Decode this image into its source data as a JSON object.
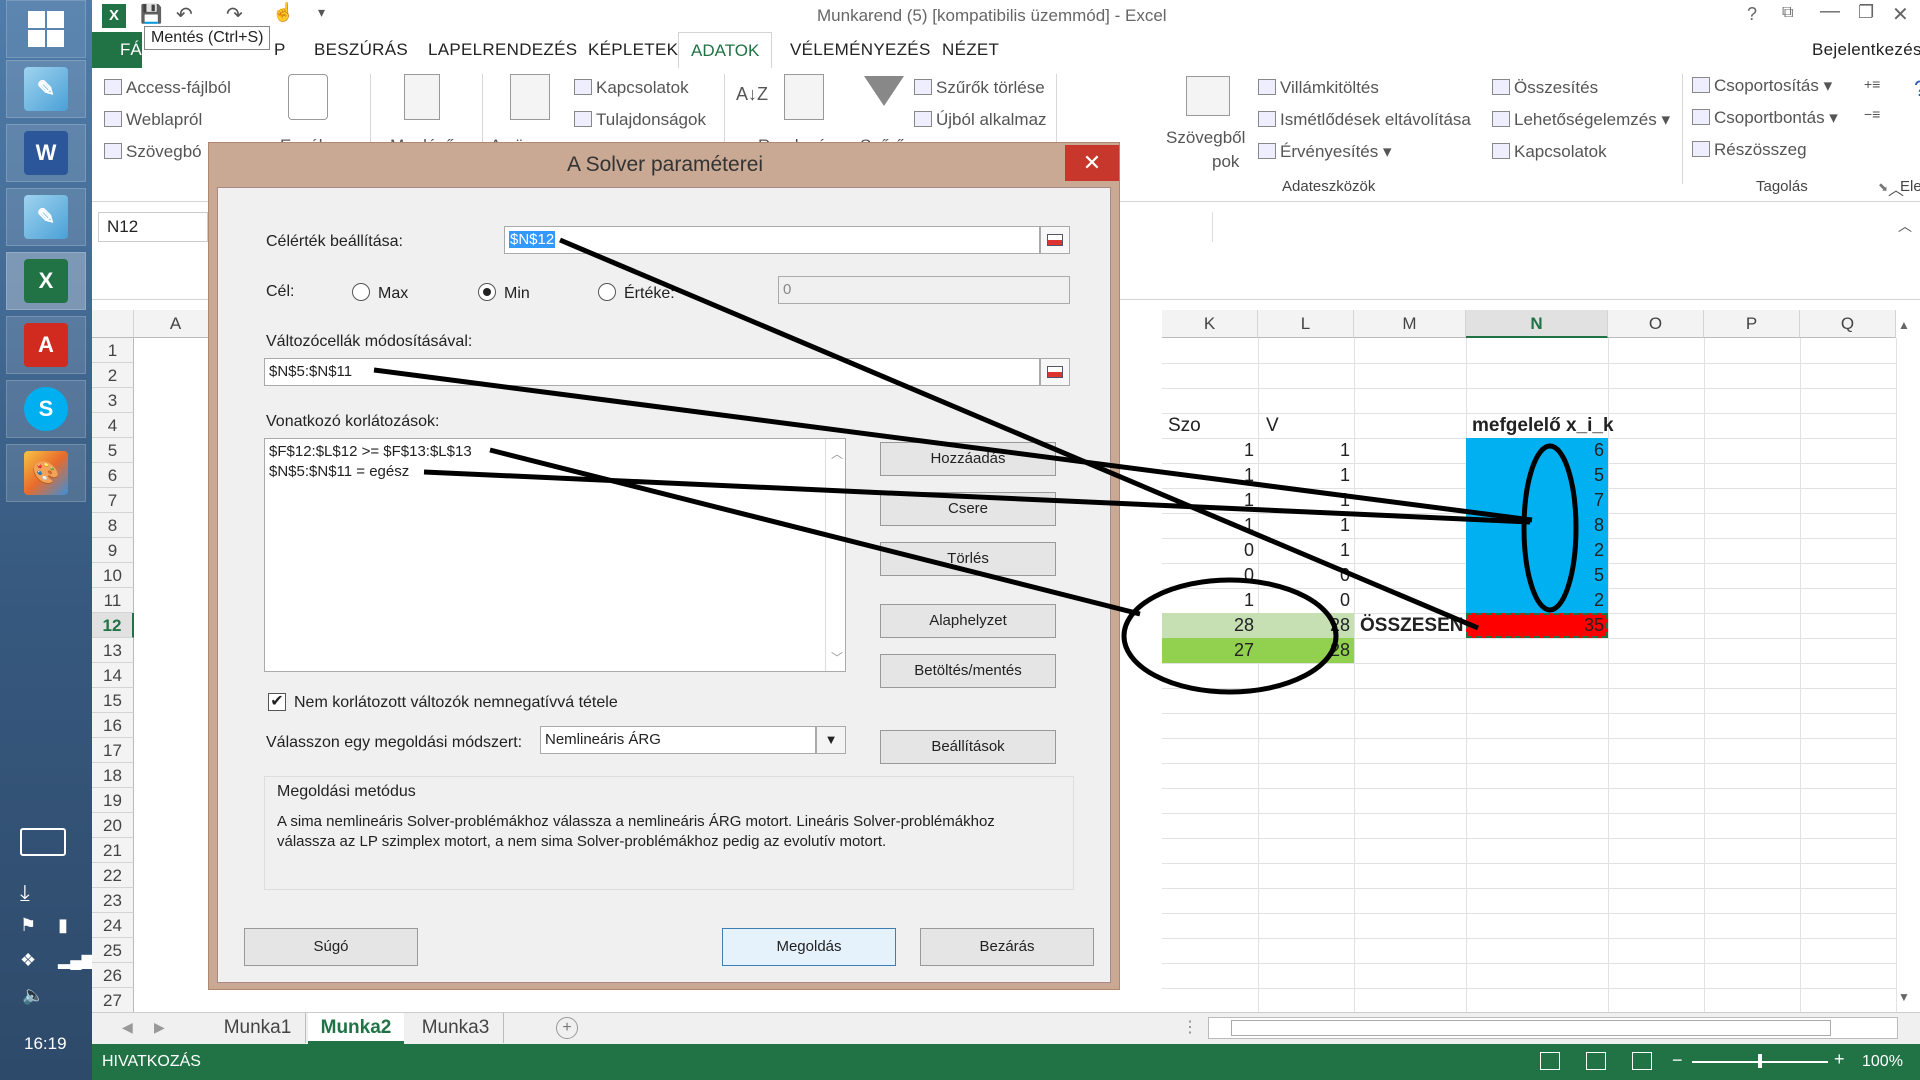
{
  "taskbar": {
    "clock": "16:19",
    "apps": [
      "windows-logo",
      "notepad-icon",
      "word-icon",
      "notepad-icon",
      "excel-icon",
      "acrobat-icon",
      "skype-icon",
      "paint-icon"
    ]
  },
  "titlebar": {
    "title": "Munkarend (5)  [kompatibilis üzemmód] - Excel",
    "tooltip": "Mentés (Ctrl+S)",
    "help": "?"
  },
  "ribbon_tabs": {
    "file": "FÁ",
    "home_tail": "P",
    "insert": "BESZÚRÁS",
    "layout": "LAPELRENDEZÉS",
    "formulas": "KÉPLETEK",
    "data": "ADATOK",
    "review": "VÉLEMÉNYEZÉS",
    "view": "NÉZET",
    "signin": "Bejelentkezés"
  },
  "ribbon": {
    "access": "Access-fájlból",
    "web": "Weblapról",
    "text": "Szövegbó",
    "other": "Egyéb",
    "existing": "Meglévő",
    "refresh_all": "Az összes",
    "connections": "Kapcsolatok",
    "properties": "Tulajdonságok",
    "sort": "Rendezés",
    "filter": "Szűrő",
    "clear_filters": "Szűrők törlése",
    "reapply": "Újból alkalmaz",
    "text_to_cols_1": "Szövegből",
    "text_to_cols_2": "pok",
    "flash_fill": "Villámkitöltés",
    "remove_dup": "Ismétlődések eltávolítása",
    "validation": "Érvényesítés",
    "consolidate": "Összesítés",
    "whatif": "Lehetőségelemzés",
    "relationships": "Kapcsolatok",
    "group": "Csoportosítás",
    "ungroup": "Csoportbontás",
    "subtotal": "Részösszeg",
    "grp_datatools": "Adateszközök",
    "grp_outline": "Tagolás",
    "grp_analysis": "Elemzés"
  },
  "namebox": "N12",
  "columns": [
    "A",
    "K",
    "L",
    "M",
    "N",
    "O",
    "P",
    "Q"
  ],
  "rows": [
    "1",
    "2",
    "3",
    "4",
    "5",
    "6",
    "7",
    "8",
    "9",
    "10",
    "11",
    "12",
    "13",
    "14",
    "15",
    "16",
    "17",
    "18",
    "19",
    "20",
    "21",
    "22",
    "23",
    "24",
    "25",
    "26",
    "27"
  ],
  "cells": {
    "j4": "Szo",
    "l4": "V",
    "n4": "mefgelelő x_i_k",
    "k_vals": [
      "1",
      "1",
      "1",
      "1",
      "0",
      "0",
      "1"
    ],
    "l_vals": [
      "1",
      "1",
      "1",
      "1",
      "1",
      "0",
      "0"
    ],
    "n_vals": [
      "6",
      "5",
      "7",
      "8",
      "2",
      "5",
      "2"
    ],
    "k12": "28",
    "l12": "28",
    "m12": "ÖSSZESEN",
    "n12": "35",
    "k13": "27",
    "l13": "28"
  },
  "sheets": {
    "s1": "Munka1",
    "s2": "Munka2",
    "s3": "Munka3"
  },
  "status": {
    "mode": "HIVATKOZÁS",
    "zoom": "100%"
  },
  "dialog": {
    "title": "A Solver paraméterei",
    "close": "✕",
    "target_label": "Célérték beállítása:",
    "target_value": "$N$12",
    "goal_label": "Cél:",
    "opt_max": "Max",
    "opt_min": "Min",
    "opt_value": "Értéke:",
    "value_field": "0",
    "vars_label": "Változócellák módosításával:",
    "vars_value": "$N$5:$N$11",
    "constraints_label": "Vonatkozó korlátozások:",
    "constraints": [
      "$F$12:$L$12 >= $F$13:$L$13",
      "$N$5:$N$11 = egész"
    ],
    "btn_add": "Hozzáadás",
    "btn_change": "Csere",
    "btn_delete": "Törlés",
    "btn_reset": "Alaphelyzet",
    "btn_loadsave": "Betöltés/mentés",
    "nonneg_label": "Nem korlátozott változók nemnegatívvá tétele",
    "method_label": "Válasszon egy megoldási módszert:",
    "method_value": "Nemlineáris ÁRG",
    "btn_options": "Beállítások",
    "method_box_title": "Megoldási metódus",
    "method_desc_1": "A sima nemlineáris Solver-problémákhoz válassza a nemlineáris ÁRG motort. Lineáris Solver-problémákhoz",
    "method_desc_2": "válassza az LP szimplex motort, a nem sima Solver-problémákhoz pedig az evolutív motort.",
    "btn_help": "Súgó",
    "btn_solve": "Megoldás",
    "btn_close": "Bezárás"
  },
  "colors": {
    "excel_green": "#217346",
    "blue_fill": "#00b0f0",
    "red_fill": "#ff0000",
    "green_light": "#c6e0b4",
    "green_mid": "#92d050"
  }
}
